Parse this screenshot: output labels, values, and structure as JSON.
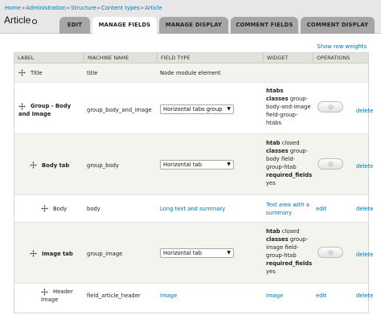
{
  "breadcrumb": [
    "Home",
    "Administration",
    "Structure",
    "Content types",
    "Article"
  ],
  "breadcrumb_separator": "»",
  "page_title": "Article",
  "tabs": [
    {
      "label": "EDIT",
      "active": false
    },
    {
      "label": "MANAGE FIELDS",
      "active": true
    },
    {
      "label": "MANAGE DISPLAY",
      "active": false
    },
    {
      "label": "COMMENT FIELDS",
      "active": false
    },
    {
      "label": "COMMENT DISPLAY",
      "active": false
    }
  ],
  "show_row_weights": "Show row weights",
  "table": {
    "headers": [
      "LABEL",
      "MACHINE NAME",
      "FIELD TYPE",
      "WIDGET",
      "OPERATIONS"
    ],
    "rows": [
      {
        "label": "Title",
        "machine": "title",
        "field_type": "Node module element"
      },
      {
        "label": "Group - Body and Image",
        "machine": "group_body_and_image",
        "select": "Horizontal tabs group",
        "widget": [
          "htabs",
          "classes",
          " group-body-and-image field-group-htabs"
        ],
        "delete": "delete"
      },
      {
        "label": "Body tab",
        "machine": "group_body",
        "select": "Horizontal tab",
        "widget": [
          "htab",
          " closed",
          "classes",
          " group-body field-group-htab",
          "required_fields",
          "yes"
        ],
        "delete": "delete"
      },
      {
        "label": "Body",
        "machine": "body",
        "field_type": "Long text and summary",
        "widget": "Text area with a summary",
        "edit": "edit",
        "delete": "delete"
      },
      {
        "label": "Image tab",
        "machine": "group_image",
        "select": "Horizontal tab",
        "widget": [
          "htab",
          " closed",
          "classes",
          " group-image field-group-htab",
          "required_fields",
          "yes"
        ],
        "delete": "delete"
      },
      {
        "label": "Header Image",
        "machine": "field_article_header",
        "field_type": "Image",
        "widget": "Image",
        "edit": "edit",
        "delete": "delete"
      }
    ]
  },
  "colors": {
    "link": "#0074bd",
    "tab_bg": "#a6a6a6",
    "header_bg": "#e7e7e7",
    "row_even": "#f3f4ee"
  },
  "icons": {
    "drag": "move-cross-icon",
    "settings": "gear-icon"
  }
}
